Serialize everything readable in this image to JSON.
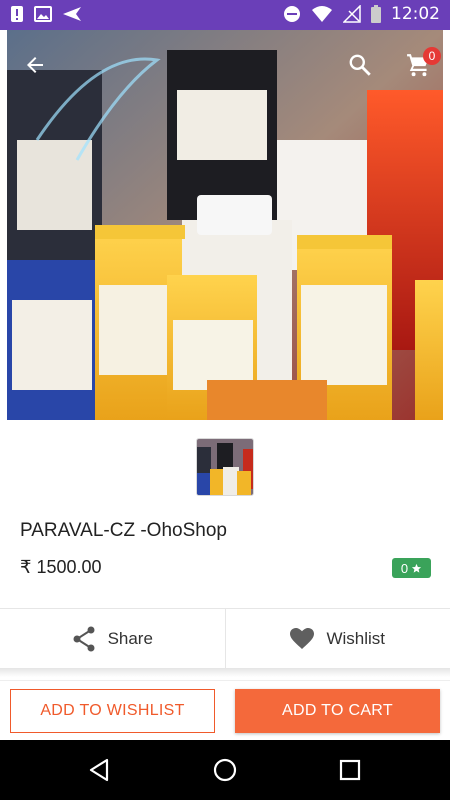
{
  "status_bar": {
    "time": "12:02"
  },
  "header": {
    "cart_count": "0"
  },
  "product": {
    "title": "PARAVAL-CZ -OhoShop",
    "price": "₹ 1500.00",
    "rating": "0"
  },
  "actions": {
    "share_label": "Share",
    "wishlist_label": "Wishlist"
  },
  "bottom": {
    "add_to_wishlist": "ADD TO WISHLIST",
    "add_to_cart": "ADD TO CART"
  },
  "colors": {
    "status_bar": "#6a3fb8",
    "accent": "#f4693b",
    "rating_green": "#3aa35a",
    "badge_red": "#e53935"
  }
}
